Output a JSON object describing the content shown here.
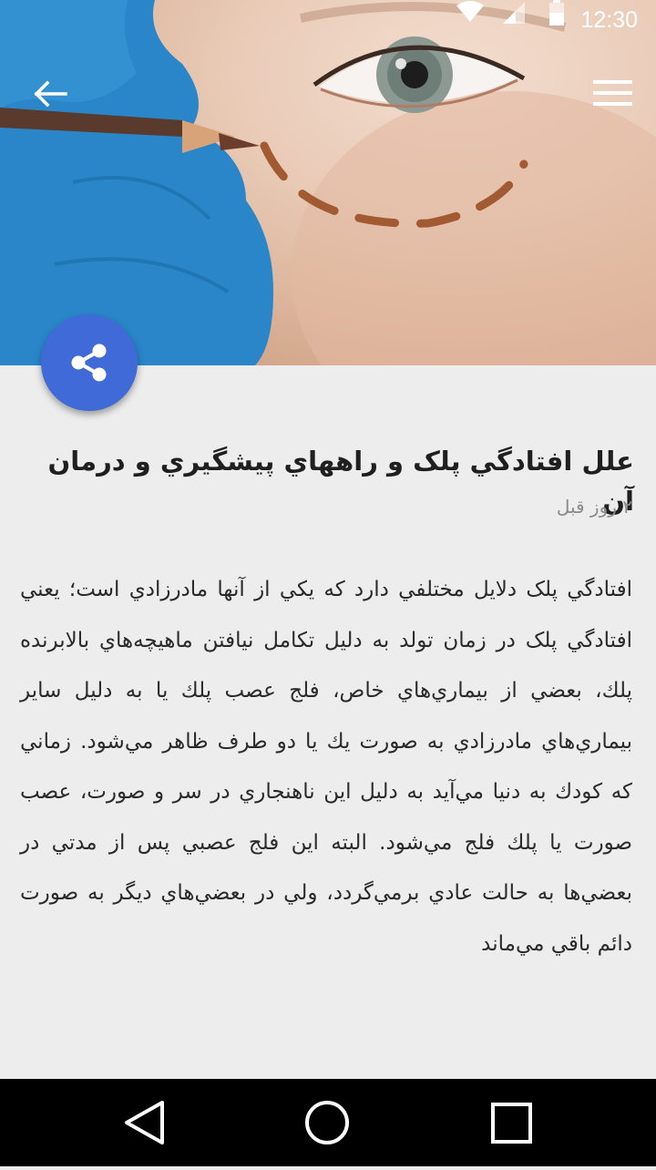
{
  "status_bar": {
    "time": "12:30"
  },
  "toolbar": {
    "back_icon": "arrow-back-icon",
    "menu_icon": "hamburger-menu-icon"
  },
  "share_fab": {
    "icon": "share-icon",
    "color": "#3f6ad8"
  },
  "article": {
    "title": "علل افتادگي پلک و راههاي پيشگيري و درمان آن",
    "date": "۲ روز قبل",
    "body": "افتادگي پلک دلايل مختلفي دارد که يکي از آنها مادرزادي است؛ يعني افتادگي پلک در زمان تولد به دليل تكامل نيافتن ماهيچه‌هاي بالابرنده پلك، بعضي از بيماري‌هاي خاص، فلج عصب پلك يا به دليل ساير بيماري‌هاي مادرزادي به صورت يك يا دو طرف ظاهر مي‌شود. زماني كه كودك به دنيا مي‌آيد به دليل اين ناهنجاري در سر و صورت، عصب صورت يا پلك فلج مي‌شود. البته اين فلج عصبي پس از مدتي در بعضي‌ها به حالت عادي برمي‌گردد، ولي در بعضي‌هاي ديگر به صورت دائم باقي مي‌ماند"
  },
  "nav_bar": {
    "back_icon": "triangle-back-icon",
    "home_icon": "circle-home-icon",
    "recents_icon": "square-recents-icon"
  }
}
